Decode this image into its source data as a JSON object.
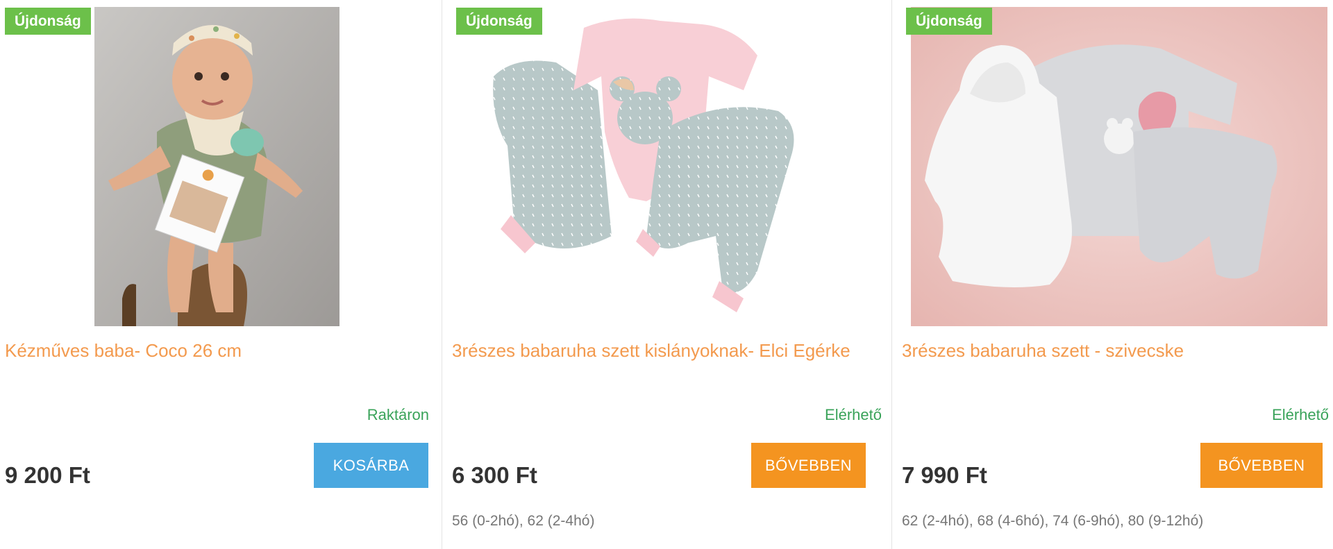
{
  "products": [
    {
      "badge": "Újdonság",
      "title": "Kézműves baba- Coco 26 cm",
      "availability": "Raktáron",
      "price": "9 200 Ft",
      "button_label": "KOSÁRBA",
      "button_color": "#4aa8e0",
      "sizes": ""
    },
    {
      "badge": "Újdonság",
      "title": "3részes babaruha szett kislányoknak- Elci Egérke",
      "availability": "Elérhető",
      "price": "6 300 Ft",
      "button_label": "BŐVEBBEN",
      "button_color": "#f49420",
      "sizes": "56 (0-2hó), 62 (2-4hó)"
    },
    {
      "badge": "Újdonság",
      "title": "3részes babaruha szett - szivecske",
      "availability": "Elérhető",
      "price": "7 990 Ft",
      "button_label": "BŐVEBBEN",
      "button_color": "#f49420",
      "sizes": "62 (2-4hó), 68 (4-6hó), 74 (6-9hó), 80 (9-12hó)"
    }
  ],
  "colors": {
    "badge_bg": "#6cc04a",
    "title": "#f39a4e",
    "availability": "#3aa35a",
    "price": "#333333"
  }
}
